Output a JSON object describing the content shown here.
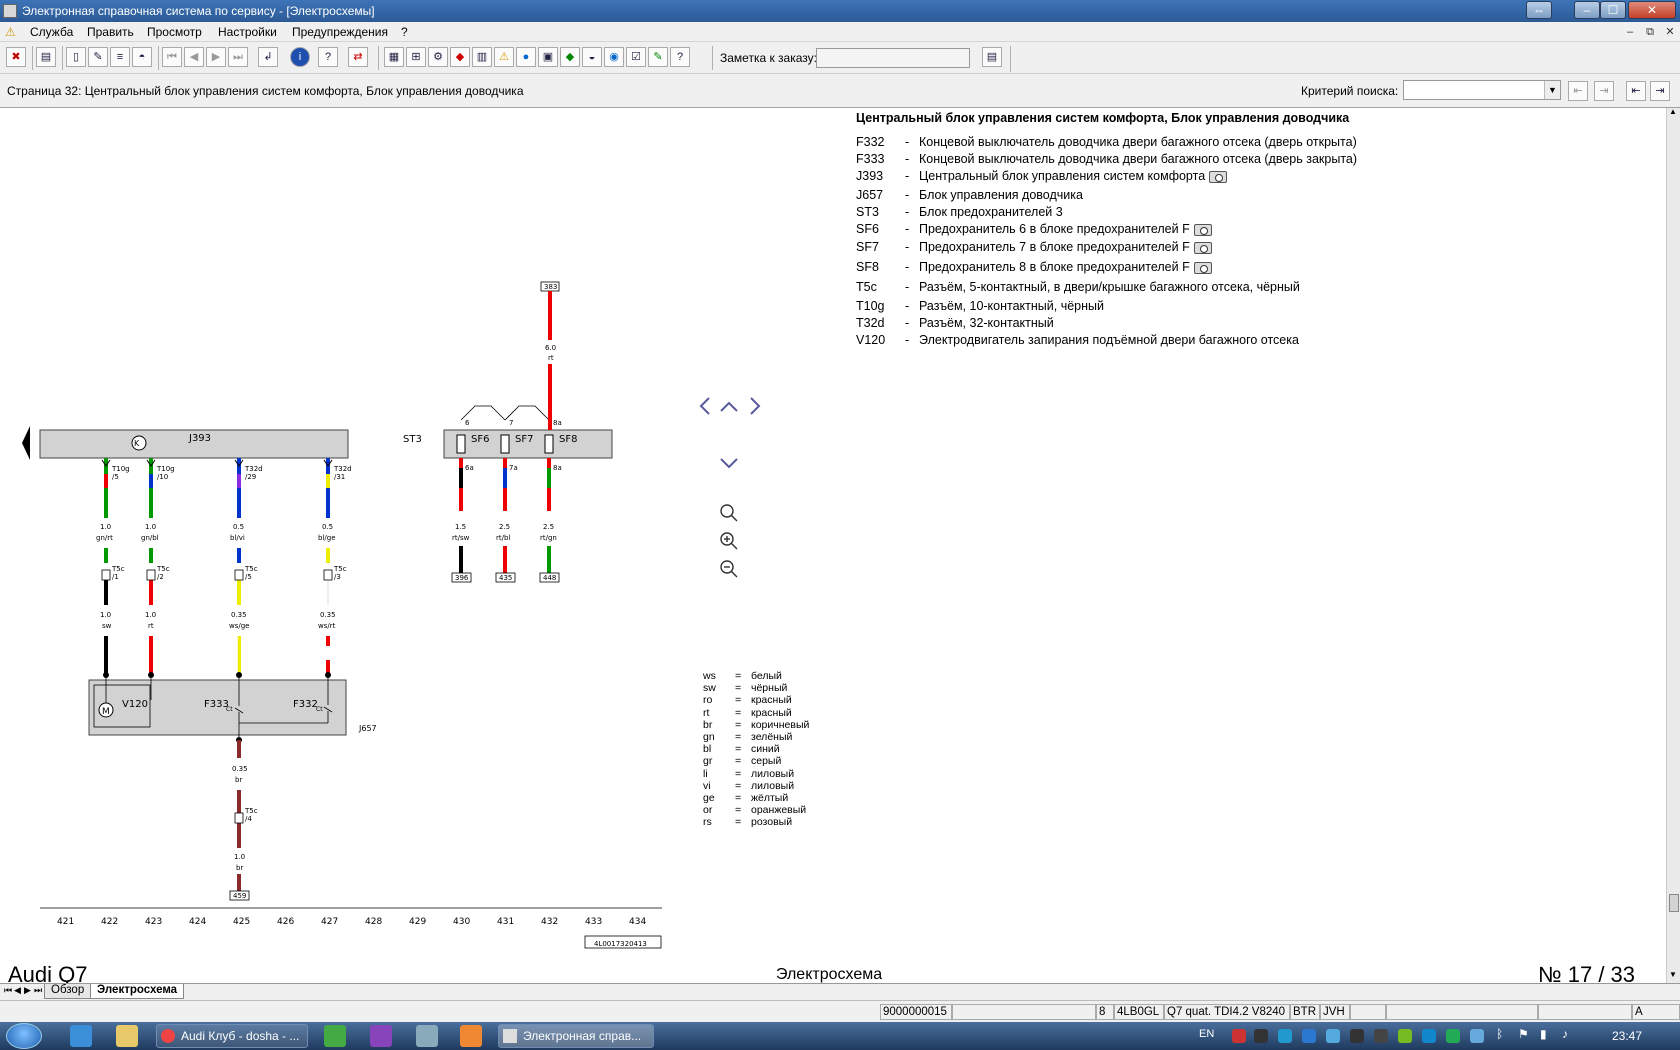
{
  "window": {
    "title": "Электронная справочная система по сервису - [Электросхемы]",
    "buttons": [
      "⇔",
      "–",
      "☐",
      "✕"
    ]
  },
  "menu": {
    "items": [
      "Служба",
      "Править",
      "Просмотр",
      "Настройки",
      "Предупреждения",
      "?"
    ],
    "mdi": [
      "–",
      "⧉",
      "✕"
    ]
  },
  "toolbar": {
    "note_label": "Заметка к заказу:",
    "note_value": ""
  },
  "infobar": {
    "page": "Страница 32: Центральный блок управления систем комфорта, Блок управления доводчика",
    "search_label": "Критерий поиска:",
    "search_value": ""
  },
  "legend": {
    "title": "Центральный блок управления систем комфорта, Блок управления доводчика",
    "items": [
      {
        "code": "F332",
        "text": "Концевой выключатель доводчика двери багажного отсека (дверь открыта)",
        "camera": false
      },
      {
        "code": "F333",
        "text": "Концевой выключатель доводчика двери багажного отсека (дверь закрыта)",
        "camera": false
      },
      {
        "code": "J393",
        "text": "Центральный блок управления систем комфорта",
        "camera": true
      },
      {
        "code": "J657",
        "text": "Блок управления доводчика",
        "camera": false
      },
      {
        "code": "ST3",
        "text": "Блок предохранителей 3",
        "camera": false
      },
      {
        "code": "SF6",
        "text": "Предохранитель 6 в блоке предохранителей F",
        "camera": true
      },
      {
        "code": "SF7",
        "text": "Предохранитель 7 в блоке предохранителей F",
        "camera": true
      },
      {
        "code": "SF8",
        "text": "Предохранитель 8 в блоке предохранителей F",
        "camera": true
      },
      {
        "code": "T5c",
        "text": "Разъём, 5-контактный, в двери/крышке багажного отсека, чёрный",
        "camera": false
      },
      {
        "code": "T10g",
        "text": "Разъём, 10-контактный, чёрный",
        "camera": false
      },
      {
        "code": "T32d",
        "text": "Разъём, 32-контактный",
        "camera": false
      },
      {
        "code": "V120",
        "text": "Электродвигатель запирания подъёмной двери багажного отсека",
        "camera": false
      }
    ]
  },
  "color_key": [
    {
      "abbr": "ws",
      "name": "белый"
    },
    {
      "abbr": "sw",
      "name": "чёрный"
    },
    {
      "abbr": "ro",
      "name": "красный"
    },
    {
      "abbr": "rt",
      "name": "красный"
    },
    {
      "abbr": "br",
      "name": "коричневый"
    },
    {
      "abbr": "gn",
      "name": "зелёный"
    },
    {
      "abbr": "bl",
      "name": "синий"
    },
    {
      "abbr": "gr",
      "name": "серый"
    },
    {
      "abbr": "li",
      "name": "лиловый"
    },
    {
      "abbr": "vi",
      "name": "лиловый"
    },
    {
      "abbr": "ge",
      "name": "жёлтый"
    },
    {
      "abbr": "or",
      "name": "оранжевый"
    },
    {
      "abbr": "rs",
      "name": "розовый"
    }
  ],
  "diagram": {
    "j393": "J393",
    "st3": "ST3",
    "j657": "J657",
    "sf6": "SF6",
    "sf7": "SF7",
    "sf8": "SF8",
    "v120": "V120",
    "f333": "F333",
    "f332": "F332",
    "motor": "M",
    "ref_top": "383",
    "top_size": "6.0",
    "top_color": "rt",
    "fuse_pins_top": [
      "6",
      "7",
      "8a"
    ],
    "fuse_pins_bottom": [
      "6a",
      "7a",
      "8a"
    ],
    "fuse_sizes": [
      "1.5",
      "2.5",
      "2.5"
    ],
    "fuse_colors": [
      "rt/sw",
      "rt/bl",
      "rt/gn"
    ],
    "fuse_refs": [
      "396",
      "435",
      "448"
    ],
    "conn_top": [
      "T10g",
      "T10g",
      "T32d",
      "T32d"
    ],
    "conn_top_pin": [
      "/5",
      "/10",
      "/29",
      "/31"
    ],
    "wire_upper_size": [
      "1.0",
      "1.0",
      "0.5",
      "0.5"
    ],
    "wire_upper_color": [
      "gn/rt",
      "gn/bl",
      "bl/vi",
      "bl/ge"
    ],
    "t5c": [
      "T5c",
      "T5c",
      "T5c",
      "T5c"
    ],
    "t5c_pin": [
      "/1",
      "/2",
      "/5",
      "/3"
    ],
    "wire_lower_size": [
      "1.0",
      "1.0",
      "0.35",
      "0.35"
    ],
    "wire_lower_color": [
      "sw",
      "rt",
      "ws/ge",
      "ws/rt"
    ],
    "ground_size1": "0.35",
    "ground_color1": "br",
    "ground_t5c": "T5c",
    "ground_t5c_pin": "/4",
    "ground_size2": "1.0",
    "ground_color2": "br",
    "ground_ref": "459",
    "track_numbers": [
      "421",
      "422",
      "423",
      "424",
      "425",
      "426",
      "427",
      "428",
      "429",
      "430",
      "431",
      "432",
      "433",
      "434"
    ],
    "doc_number": "4L0017320413",
    "c_labels": [
      "Ct",
      "Ct"
    ]
  },
  "footer": {
    "model": "Audi Q7",
    "center": "Электросхема",
    "page_prefix": "№",
    "page": "17 / 33"
  },
  "tabs": [
    "Обзор",
    "Электросхема"
  ],
  "status": {
    "order": "9000000015",
    "num": "8",
    "code": "4LB0GL",
    "engine": "Q7 quat. TDI4.2 V8240",
    "f1": "BTR",
    "f2": "JVH",
    "mode": "A"
  },
  "taskbar": {
    "items": [
      "Audi Клуб - dosha - ...",
      "Электронная справ..."
    ],
    "lang": "EN",
    "time": "23:47"
  }
}
